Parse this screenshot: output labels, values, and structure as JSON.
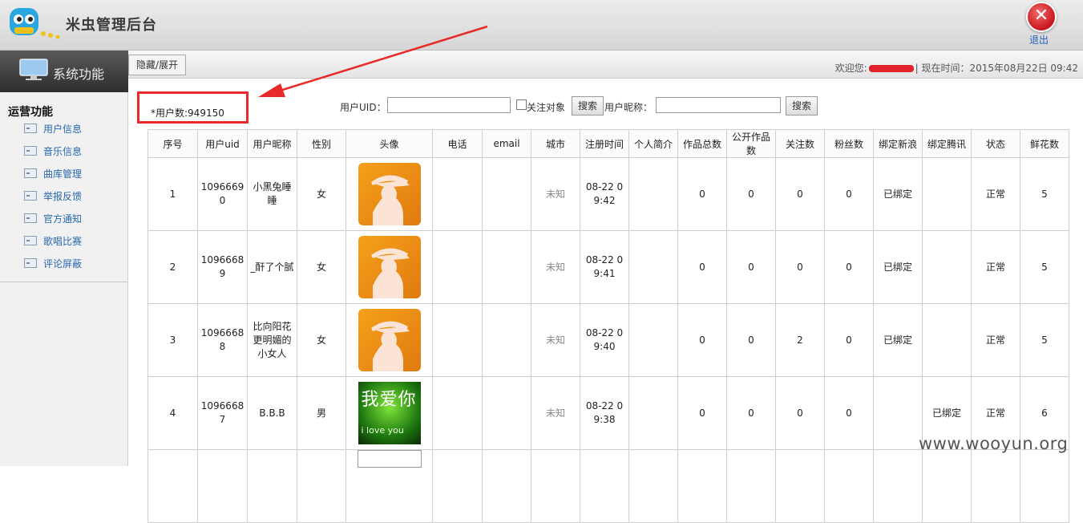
{
  "app": {
    "title": "米虫管理后台",
    "logout_label": "退出"
  },
  "side_header": {
    "title": "系统功能"
  },
  "topbar": {
    "toggle_label": "隐藏/展开",
    "welcome_prefix": "欢迎您:",
    "time_text": "| 现在时间：2015年08月22日 09:42"
  },
  "sidebar": {
    "section_title": "运营功能",
    "items": [
      {
        "label": "用户信息"
      },
      {
        "label": "音乐信息"
      },
      {
        "label": "曲库管理"
      },
      {
        "label": "举报反馈"
      },
      {
        "label": "官方通知"
      },
      {
        "label": "歌唱比赛"
      },
      {
        "label": "评论屏蔽"
      }
    ]
  },
  "search": {
    "user_count": "*用户数:949150",
    "uid_label": "用户UID：",
    "follow_label": "关注对象",
    "search_label": "搜索",
    "nick_label": "用户昵称："
  },
  "table": {
    "columns": [
      "序号",
      "用户uid",
      "用户昵称",
      "性别",
      "头像",
      "电话",
      "email",
      "城市",
      "注册时间",
      "个人简介",
      "作品总数",
      "公开作品数",
      "关注数",
      "粉丝数",
      "绑定新浪",
      "绑定腾讯",
      "状态",
      "鲜花数"
    ],
    "rows": [
      {
        "no": "1",
        "uid": "10966690",
        "nick": "小黑兔睡睡",
        "gender": "女",
        "avatar": "orange",
        "phone": "",
        "email": "",
        "city": "未知",
        "reg": "08-22 09:42",
        "bio": "",
        "works": "0",
        "public_works": "0",
        "follows": "0",
        "fans": "0",
        "sina": "已绑定",
        "tencent": "",
        "status": "正常",
        "flowers": "5"
      },
      {
        "no": "2",
        "uid": "10966689",
        "nick": "_酐了个腻",
        "gender": "女",
        "avatar": "orange",
        "phone": "",
        "email": "",
        "city": "未知",
        "reg": "08-22 09:41",
        "bio": "",
        "works": "0",
        "public_works": "0",
        "follows": "0",
        "fans": "0",
        "sina": "已绑定",
        "tencent": "",
        "status": "正常",
        "flowers": "5"
      },
      {
        "no": "3",
        "uid": "10966688",
        "nick": "比向阳花更明媚的小女人",
        "gender": "女",
        "avatar": "orange",
        "phone": "",
        "email": "",
        "city": "未知",
        "reg": "08-22 09:40",
        "bio": "",
        "works": "0",
        "public_works": "0",
        "follows": "2",
        "fans": "0",
        "sina": "已绑定",
        "tencent": "",
        "status": "正常",
        "flowers": "5"
      },
      {
        "no": "4",
        "uid": "10966687",
        "nick": "B.B.B",
        "gender": "男",
        "avatar": "green",
        "phone": "",
        "email": "",
        "city": "未知",
        "reg": "08-22 09:38",
        "bio": "",
        "works": "0",
        "public_works": "0",
        "follows": "0",
        "fans": "0",
        "sina": "",
        "tencent": "已绑定",
        "status": "正常",
        "flowers": "6"
      }
    ]
  },
  "avatar_text": {
    "line1": "我爱你",
    "line2": "i love you"
  },
  "watermark": "www.wooyun.org",
  "colors": {
    "accent_red": "#e82a2a",
    "link_blue": "#2868b0"
  }
}
